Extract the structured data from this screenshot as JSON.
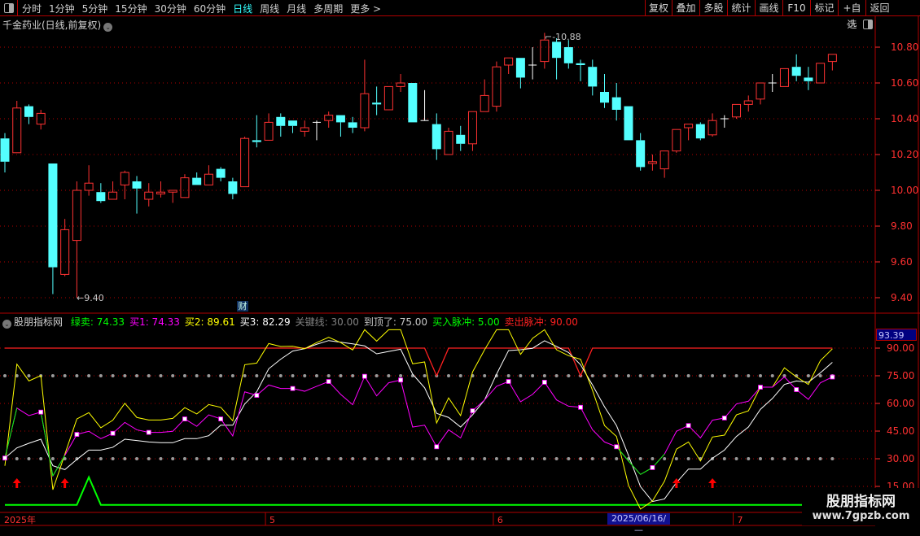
{
  "toolbar": {
    "periods": [
      "分时",
      "1分钟",
      "5分钟",
      "15分钟",
      "30分钟",
      "60分钟",
      "日线",
      "周线",
      "月线",
      "多周期",
      "更多 >"
    ],
    "active_period": "日线",
    "buttons": [
      "复权",
      "叠加",
      "多股",
      "统计",
      "画线",
      "F10",
      "标记",
      "+自选",
      "返回"
    ]
  },
  "stock": {
    "title": "千金药业(日线,前复权)",
    "high_label": "10.88",
    "low_label": "9.40",
    "event_badge": "财"
  },
  "price_axis": {
    "labels": [
      "10.80",
      "10.60",
      "10.40",
      "10.20",
      "10.00",
      "9.80",
      "9.60",
      "9.40"
    ],
    "values": [
      10.8,
      10.6,
      10.4,
      10.2,
      10.0,
      9.8,
      9.6,
      9.4
    ]
  },
  "candles": [
    [
      10.29,
      10.32,
      10.1,
      10.16
    ],
    [
      10.21,
      10.5,
      10.21,
      10.46
    ],
    [
      10.47,
      10.48,
      10.37,
      10.41
    ],
    [
      10.37,
      10.45,
      10.34,
      10.43
    ],
    [
      10.15,
      10.15,
      9.42,
      9.57
    ],
    [
      9.53,
      9.84,
      9.52,
      9.78
    ],
    [
      9.72,
      10.05,
      9.4,
      10.0
    ],
    [
      10.0,
      10.14,
      9.97,
      10.04
    ],
    [
      9.99,
      10.04,
      9.93,
      9.94
    ],
    [
      9.95,
      10.05,
      9.95,
      9.99
    ],
    [
      10.03,
      10.11,
      9.95,
      10.1
    ],
    [
      10.05,
      10.08,
      9.87,
      10.01
    ],
    [
      9.95,
      10.04,
      9.91,
      9.99
    ],
    [
      9.98,
      10.05,
      9.96,
      9.99
    ],
    [
      9.99,
      10.0,
      9.93,
      10.0
    ],
    [
      9.96,
      10.09,
      9.96,
      10.07
    ],
    [
      10.07,
      10.1,
      10.03,
      10.03
    ],
    [
      10.03,
      10.14,
      10.03,
      10.09
    ],
    [
      10.12,
      10.13,
      10.05,
      10.07
    ],
    [
      10.05,
      10.07,
      9.95,
      9.98
    ],
    [
      10.02,
      10.3,
      10.02,
      10.29
    ],
    [
      10.28,
      10.42,
      10.24,
      10.27
    ],
    [
      10.28,
      10.43,
      10.28,
      10.38
    ],
    [
      10.41,
      10.43,
      10.3,
      10.36
    ],
    [
      10.39,
      10.39,
      10.32,
      10.36
    ],
    [
      10.33,
      10.39,
      10.3,
      10.35
    ],
    [
      10.38,
      10.39,
      10.28,
      10.38
    ],
    [
      10.39,
      10.44,
      10.35,
      10.42
    ],
    [
      10.42,
      10.42,
      10.3,
      10.38
    ],
    [
      10.38,
      10.41,
      10.32,
      10.35
    ],
    [
      10.35,
      10.73,
      10.33,
      10.54
    ],
    [
      10.49,
      10.58,
      10.42,
      10.48
    ],
    [
      10.45,
      10.58,
      10.45,
      10.58
    ],
    [
      10.58,
      10.65,
      10.55,
      10.6
    ],
    [
      10.6,
      10.6,
      10.38,
      10.38
    ],
    [
      10.39,
      10.56,
      10.39,
      10.39
    ],
    [
      10.37,
      10.43,
      10.17,
      10.23
    ],
    [
      10.2,
      10.35,
      10.2,
      10.33
    ],
    [
      10.31,
      10.36,
      10.22,
      10.26
    ],
    [
      10.26,
      10.44,
      10.22,
      10.44
    ],
    [
      10.44,
      10.62,
      10.44,
      10.53
    ],
    [
      10.47,
      10.72,
      10.44,
      10.69
    ],
    [
      10.7,
      10.74,
      10.65,
      10.74
    ],
    [
      10.74,
      10.74,
      10.57,
      10.63
    ],
    [
      10.7,
      10.8,
      10.62,
      10.7
    ],
    [
      10.72,
      10.88,
      10.68,
      10.84
    ],
    [
      10.83,
      10.85,
      10.62,
      10.74
    ],
    [
      10.8,
      10.84,
      10.68,
      10.71
    ],
    [
      10.71,
      10.73,
      10.61,
      10.7
    ],
    [
      10.69,
      10.73,
      10.53,
      10.58
    ],
    [
      10.55,
      10.65,
      10.46,
      10.49
    ],
    [
      10.52,
      10.6,
      10.39,
      10.45
    ],
    [
      10.47,
      10.47,
      10.28,
      10.28
    ],
    [
      10.28,
      10.32,
      10.11,
      10.13
    ],
    [
      10.15,
      10.2,
      10.11,
      10.16
    ],
    [
      10.12,
      10.22,
      10.07,
      10.22
    ],
    [
      10.22,
      10.34,
      10.21,
      10.34
    ],
    [
      10.35,
      10.37,
      10.28,
      10.37
    ],
    [
      10.37,
      10.38,
      10.28,
      10.29
    ],
    [
      10.31,
      10.43,
      10.3,
      10.39
    ],
    [
      10.4,
      10.42,
      10.35,
      10.4
    ],
    [
      10.41,
      10.48,
      10.4,
      10.48
    ],
    [
      10.48,
      10.53,
      10.44,
      10.5
    ],
    [
      10.51,
      10.6,
      10.48,
      10.6
    ],
    [
      10.6,
      10.65,
      10.55,
      10.6
    ],
    [
      10.58,
      10.68,
      10.58,
      10.68
    ],
    [
      10.69,
      10.76,
      10.61,
      10.64
    ],
    [
      10.63,
      10.69,
      10.56,
      10.61
    ],
    [
      10.6,
      10.71,
      10.6,
      10.71
    ],
    [
      10.72,
      10.76,
      10.67,
      10.76
    ]
  ],
  "indicator": {
    "name": "股朋指标网",
    "legend": [
      {
        "label": "绿卖: 74.33",
        "color": "#00ff00"
      },
      {
        "label": "买1: 74.33",
        "color": "#ff00ff"
      },
      {
        "label": "买2: 89.61",
        "color": "#ffff00"
      },
      {
        "label": "买3: 82.29",
        "color": "#ffffff"
      },
      {
        "label": "关键线: 30.00",
        "color": "#808080"
      },
      {
        "label": "到顶了: 75.00",
        "color": "#c8c8c8"
      },
      {
        "label": "买入脉冲: 5.00",
        "color": "#00ff00"
      },
      {
        "label": "卖出脉冲: 90.00",
        "color": "#ff2020"
      }
    ],
    "current_value": "93.39",
    "axis_labels": [
      "90.00",
      "75.00",
      "60.00",
      "45.00",
      "30.00",
      "15.00"
    ],
    "axis_values": [
      90,
      75,
      60,
      45,
      30,
      15
    ],
    "key_line": 30,
    "top_line": 75,
    "buy1": [
      30.4,
      57.5,
      53.4,
      55.3,
      20.7,
      31.8,
      43.2,
      44.9,
      40.9,
      43.8,
      49.7,
      45.7,
      44.3,
      44.3,
      44.9,
      51.6,
      47.6,
      53.8,
      51.6,
      42.4,
      66.3,
      64.4,
      70.0,
      68.1,
      68.1,
      66.6,
      69.3,
      71.9,
      64.9,
      59.3,
      74.7,
      64.1,
      71.2,
      72.7,
      47.2,
      48.2,
      36.5,
      45.7,
      41.3,
      56.0,
      61.9,
      69.3,
      71.9,
      60.9,
      64.9,
      71.5,
      61.9,
      58.5,
      57.9,
      45.7,
      39.1,
      36.5,
      28.8,
      21.5,
      25.2,
      32.5,
      44.9,
      48.0,
      41.3,
      50.9,
      52.1,
      59.7,
      61.2,
      68.8,
      68.8,
      74.4,
      67.5,
      62.2,
      71.2,
      74.33
    ],
    "green_sell_mask": [
      1,
      1,
      0,
      1,
      1,
      1,
      0,
      0,
      0,
      0,
      0,
      0,
      0,
      0,
      0,
      0,
      0,
      0,
      0,
      0,
      0,
      0,
      0,
      0,
      0,
      0,
      0,
      0,
      0,
      0,
      0,
      0,
      0,
      0,
      0,
      0,
      0,
      0,
      0,
      0,
      0,
      0,
      0,
      0,
      0,
      0,
      0,
      0,
      0,
      0,
      0,
      1,
      1,
      1,
      1,
      1,
      0,
      0,
      0,
      0,
      0,
      0,
      0,
      0,
      0,
      0,
      0,
      0,
      0,
      0
    ],
    "buy2": [
      26.2,
      81.3,
      72.2,
      75.1,
      13.2,
      32.4,
      51.6,
      55.0,
      46.8,
      50.9,
      60.1,
      52.4,
      51.0,
      51.0,
      51.9,
      57.7,
      54.3,
      59.4,
      57.9,
      50.6,
      81.0,
      81.9,
      92.5,
      90.9,
      91.0,
      89.7,
      93.0,
      95.9,
      93.0,
      89.0,
      100,
      93.8,
      100,
      100,
      81.5,
      82.5,
      49.4,
      63.0,
      53.4,
      77.1,
      89.1,
      100,
      100,
      86.6,
      95.3,
      100,
      89.1,
      85.9,
      84.0,
      67.1,
      48.0,
      42.1,
      15.6,
      2.7,
      7.1,
      17.8,
      35.2,
      39.1,
      28.8,
      41.8,
      42.8,
      53.8,
      56.0,
      68.8,
      68.8,
      79.3,
      74.4,
      70.3,
      83.2,
      89.61
    ],
    "buy3": [
      30.4,
      35.9,
      38.4,
      40.6,
      26.2,
      24.1,
      29.6,
      34.7,
      34.7,
      36.2,
      40.6,
      39.9,
      39.1,
      38.7,
      38.7,
      40.9,
      40.9,
      42.5,
      48.2,
      48.2,
      59.7,
      66.3,
      78.8,
      84.0,
      88.4,
      89.7,
      92.1,
      94.1,
      93.2,
      92.3,
      91.2,
      86.9,
      88.2,
      89.4,
      75.9,
      68.5,
      54.6,
      52.4,
      47.2,
      53.8,
      61.9,
      75.9,
      88.7,
      89.1,
      89.9,
      94.0,
      90.9,
      87.6,
      81.0,
      70.0,
      58.2,
      48.0,
      31.8,
      14.9,
      6.8,
      8.2,
      17.1,
      24.4,
      24.4,
      30.3,
      34.7,
      42.1,
      47.2,
      56.8,
      62.7,
      70.3,
      72.2,
      71.5,
      76.6,
      82.29
    ],
    "sell_pulse_dips": [
      36,
      48
    ],
    "buy_pulse_peaks": [
      7
    ],
    "buy_arrows": [
      1,
      5,
      56,
      59
    ]
  },
  "date_axis": {
    "labels": [
      {
        "text": "2025年",
        "index": 0
      },
      {
        "text": "5",
        "index": 22
      },
      {
        "text": "6",
        "index": 41
      },
      {
        "text": "7",
        "index": 61
      }
    ],
    "cursor_date": "2025/06/16/—"
  },
  "watermark": {
    "line1": "股朋指标网",
    "line2": "www.7gpzb.com"
  },
  "colors": {
    "up": "#ff3232",
    "down": "#54ffff",
    "grid": "#b00000",
    "axis": "#ff3030"
  }
}
